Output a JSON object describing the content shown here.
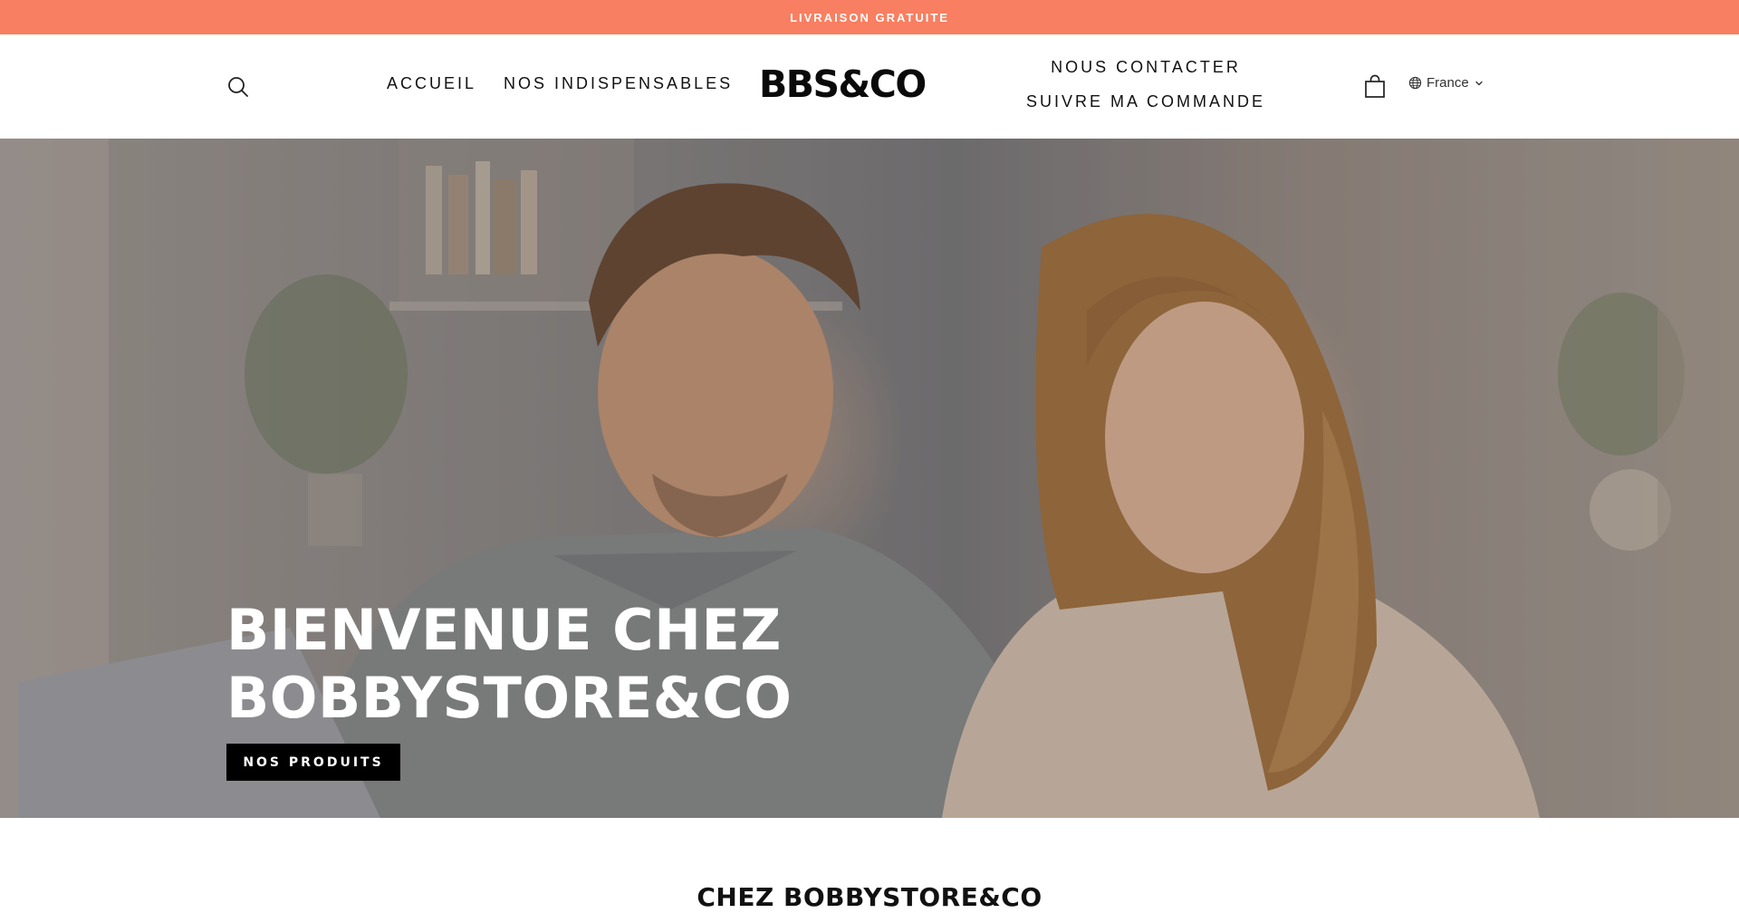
{
  "announcement": {
    "text": "LIVRAISON GRATUITE"
  },
  "header": {
    "logo": "BBS&CO",
    "nav_left": [
      "ACCUEIL",
      "NOS INDISPENSABLES"
    ],
    "nav_right": [
      "NOUS CONTACTER",
      "SUIVRE MA COMMANDE"
    ],
    "locale": "France",
    "icons": {
      "search": "search-icon",
      "cart": "shopping-bag-icon",
      "locale": "globe-icon",
      "locale_caret": "chevron-down-icon"
    }
  },
  "hero": {
    "title": "BIENVENUE CHEZ BOBBYSTORE&CO",
    "cta_label": "NOS PRODUITS"
  },
  "section": {
    "heading": "CHEZ BOBBYSTORE&CO"
  },
  "colors": {
    "announcement_bg": "#f87f61",
    "header_bg": "#ffffff",
    "cta_bg": "#000000",
    "hero_text": "#ffffff"
  }
}
